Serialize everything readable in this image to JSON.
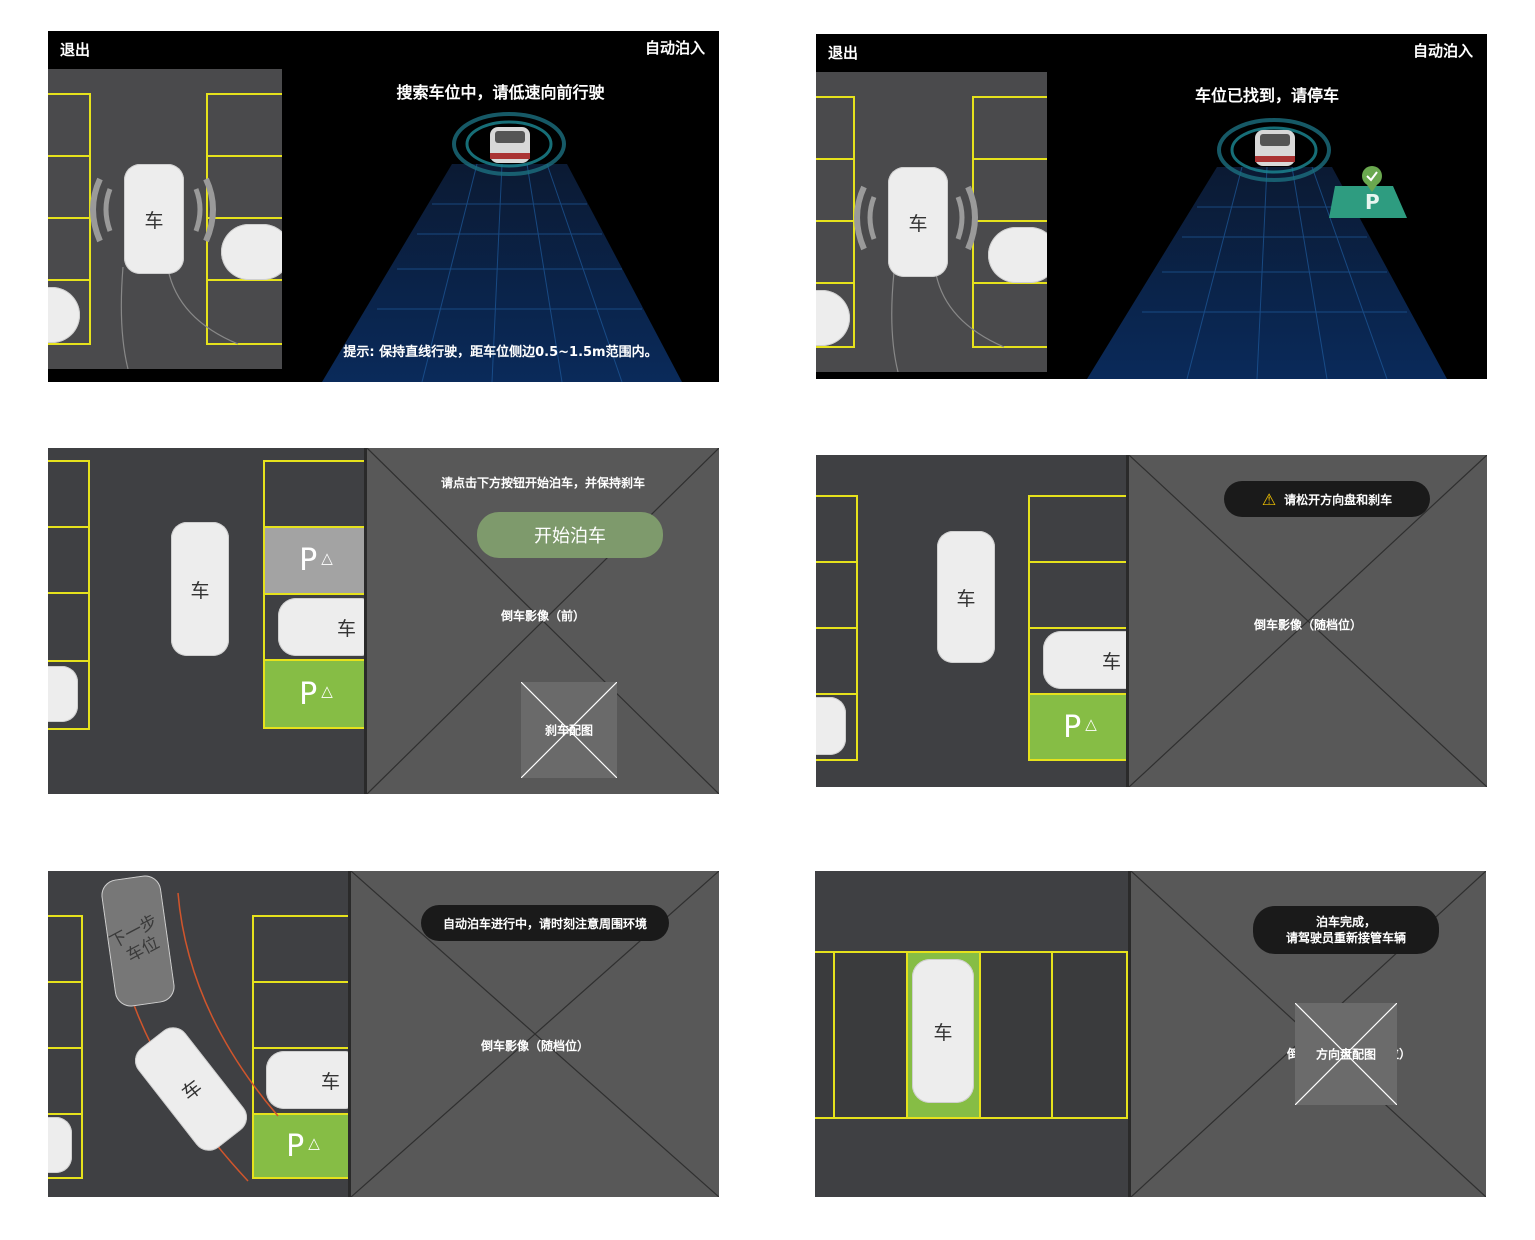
{
  "screens": {
    "s1": {
      "exit": "退出",
      "mode": "自动泊入",
      "title": "搜索车位中，请低速向前行驶",
      "tip": "提示: 保持直线行驶，距车位侧边0.5~1.5m范围内。",
      "car": "车"
    },
    "s2": {
      "exit": "退出",
      "mode": "自动泊入",
      "title": "车位已找到，请停车",
      "car": "车",
      "p": "P"
    },
    "s3": {
      "instruction": "请点击下方按钮开始泊车，并保持刹车",
      "start_button": "开始泊车",
      "camera": "倒车影像（前）",
      "brake_image": "刹车配图",
      "car": "车",
      "parked_car": "车",
      "p1": "P",
      "p2": "P"
    },
    "s4": {
      "warning": "请松开方向盘和刹车",
      "camera": "倒车影像（随档位）",
      "car": "车",
      "parked_car": "车",
      "p": "P"
    },
    "s5": {
      "status": "自动泊车进行中，请时刻注意周围环境",
      "camera": "倒车影像（随档位）",
      "next_slot": "下一步\n车位",
      "car": "车",
      "parked_car": "车",
      "p": "P"
    },
    "s6": {
      "done_line1": "泊车完成，",
      "done_line2": "请驾驶员重新接管车辆",
      "camera_hidden_left": "倒",
      "wheel_image": "方向盘配图",
      "camera_hidden_right": "位）",
      "car": "车"
    }
  },
  "colors": {
    "slot_line": "#e6e21c",
    "target_green": "#86bd45",
    "occupied_grey": "#a3a3a3",
    "button_green": "#7e9a6c",
    "path_red": "#d0552c"
  }
}
